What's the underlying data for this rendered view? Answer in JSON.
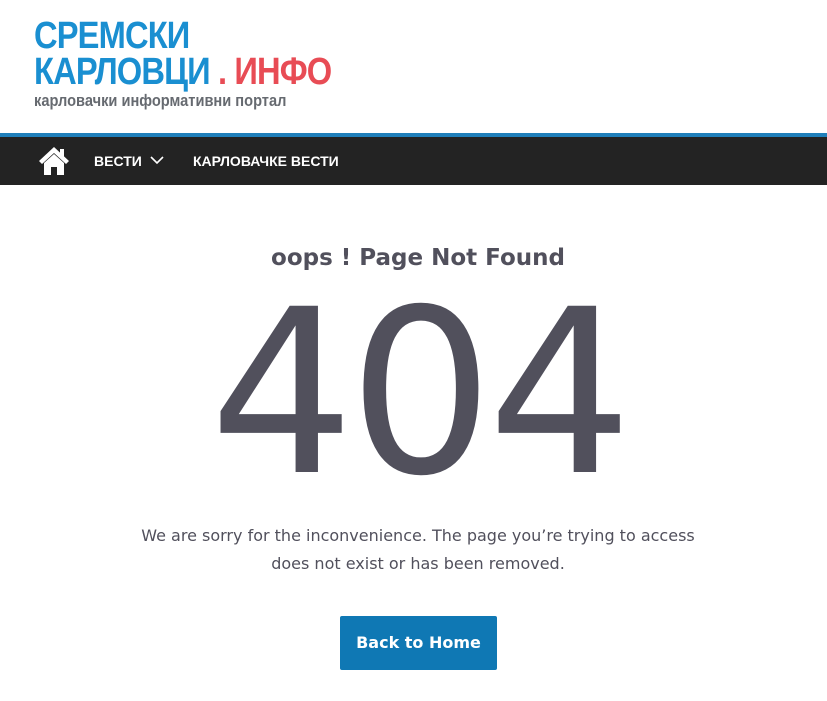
{
  "site": {
    "logo_line1": "СРЕМСКИ",
    "logo_line2_main": "КАРЛОВЦИ",
    "logo_line2_accent": ". ИНФО",
    "tagline": "карловачки информативни портал"
  },
  "nav": {
    "home_icon": "home-icon",
    "items": [
      {
        "label": "ВЕСТИ",
        "has_dropdown": true
      },
      {
        "label": "КАРЛОВАЧКЕ ВЕСТИ",
        "has_dropdown": false
      }
    ]
  },
  "error": {
    "heading": "oops ! Page Not Found",
    "code": "404",
    "message": "We are sorry for the inconvenience. The page you’re trying to access does not exist or has been removed.",
    "button_label": "Back to Home"
  },
  "colors": {
    "logo_blue": "#1a8fd1",
    "logo_red": "#e84c55",
    "nav_bg": "#232323",
    "nav_accent": "#1f7fba",
    "text_dark": "#51505c",
    "button_bg": "#0f78b4"
  }
}
